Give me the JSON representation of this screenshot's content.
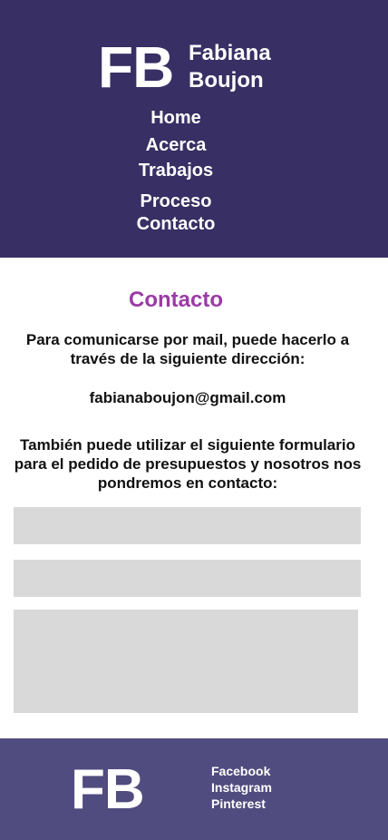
{
  "header": {
    "logo_initials": "FB",
    "logo_first_name": "Fabiana",
    "logo_last_name": "Boujon",
    "nav": [
      {
        "label": "Home"
      },
      {
        "label": "Acerca"
      },
      {
        "label": "Trabajos"
      },
      {
        "label": "Proceso"
      },
      {
        "label": "Contacto"
      }
    ]
  },
  "main": {
    "title": "Contacto",
    "intro_line1": "Para comunicarse por mail, puede hacerlo a",
    "intro_line2": "través de la siguiente dirección:",
    "email": "fabianaboujon@gmail.com",
    "form_line1": "También puede utilizar el siguiente formulario",
    "form_line2": "para el pedido de presupuestos y nosotros nos",
    "form_line3": "pondremos en contacto:"
  },
  "footer": {
    "logo_initials": "FB",
    "social": [
      {
        "label": "Facebook"
      },
      {
        "label": "Instagram"
      },
      {
        "label": "Pinterest"
      }
    ]
  },
  "colors": {
    "header_bg": "#382f64",
    "footer_bg": "#514c7f",
    "title_accent": "#9b3aa6",
    "field_bg": "#d9d9d9"
  }
}
